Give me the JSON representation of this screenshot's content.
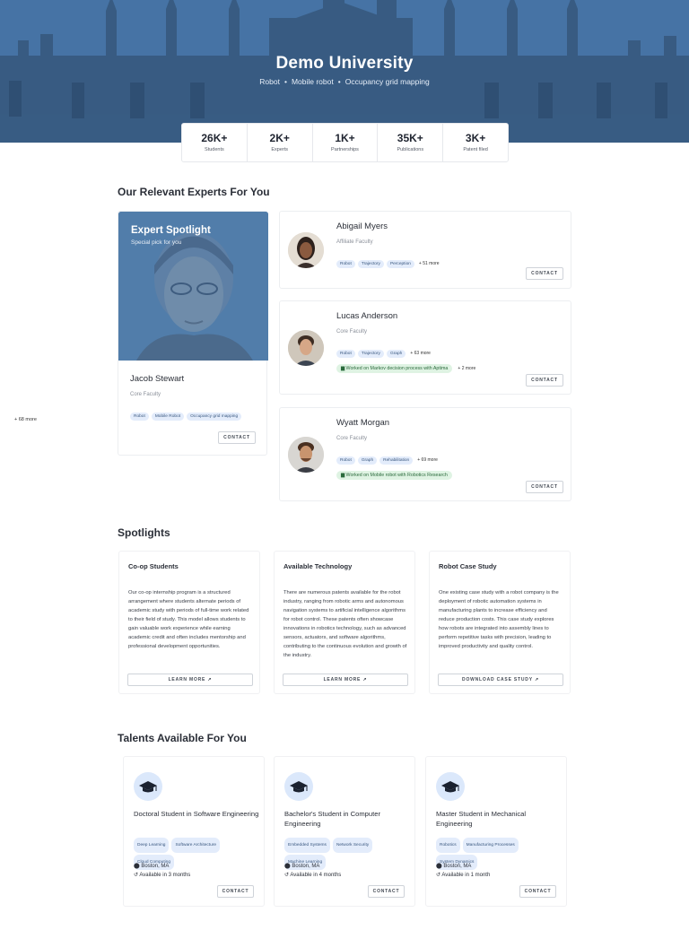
{
  "hero": {
    "title": "Demo University",
    "tags": [
      "Robot",
      "Mobile robot",
      "Occupancy grid mapping"
    ]
  },
  "stats": [
    {
      "value": "26K+",
      "label": "Students"
    },
    {
      "value": "2K+",
      "label": "Experts"
    },
    {
      "value": "1K+",
      "label": "Partnerships"
    },
    {
      "value": "35K+",
      "label": "Publications"
    },
    {
      "value": "3K+",
      "label": "Patent filed"
    }
  ],
  "experts_section": {
    "title": "Our Relevant Experts For You",
    "spotlight": {
      "heading": "Expert Spotlight",
      "subheading": "Special pick for you",
      "name": "Jacob Stewart",
      "role": "Core Faculty",
      "tags": [
        "Robot",
        "Mobile Robot",
        "Occupancy grid mapping"
      ],
      "more": "+ 68 more",
      "contact": "CONTACT"
    },
    "list": [
      {
        "name": "Abigail Myers",
        "role": "Affiliate Faculty",
        "tags": [
          "Robot",
          "Trajectory",
          "Perception"
        ],
        "more": "+ 51 more",
        "worked": "",
        "worked_more": "",
        "contact": "CONTACT"
      },
      {
        "name": "Lucas Anderson",
        "role": "Core Faculty",
        "tags": [
          "Robot",
          "Trajectory",
          "Graph"
        ],
        "more": "+ 63 more",
        "worked": "Worked on Markov decision process with Aptima",
        "worked_more": "+ 2 more",
        "contact": "CONTACT"
      },
      {
        "name": "Wyatt Morgan",
        "role": "Core Faculty",
        "tags": [
          "Robot",
          "Graph",
          "Rehabilitation"
        ],
        "more": "+ 69 more",
        "worked": "Worked on Mobile robot with Robotics Research",
        "worked_more": "",
        "contact": "CONTACT"
      }
    ]
  },
  "spotlights": {
    "title": "Spotlights",
    "cards": [
      {
        "title": "Co-op Students",
        "body": "Our co-op internship program is a structured arrangement where students alternate periods of academic study with periods of full-time work related to their field of study. This model allows students to gain valuable work experience while earning academic credit and often includes mentorship and professional development opportunities.",
        "button": "LEARN MORE"
      },
      {
        "title": "Available Technology",
        "body": "There are numerous patents available for the robot industry, ranging from robotic arms and autonomous navigation systems to artificial intelligence algorithms for robot control. These patents often showcase innovations in robotics technology, such as advanced sensors, actuators, and software algorithms, contributing to the continuous evolution and growth of the industry.",
        "button": "LEARN MORE"
      },
      {
        "title": "Robot Case Study",
        "body": "One existing case study with a robot company is the deployment of robotic automation systems in manufacturing plants to increase efficiency and reduce production costs. This case study explores how robots are integrated into assembly lines to perform repetitive tasks with precision, leading to improved productivity and quality control.",
        "button": "DOWNLOAD CASE STUDY"
      }
    ]
  },
  "talents": {
    "title": "Talents Available For You",
    "cards": [
      {
        "title": "Doctoral Student in Software Engineering",
        "tags": [
          "Deep Learning",
          "Software Architecture",
          "Cloud Computing"
        ],
        "location": "Boston, MA",
        "availability": "Available in 3 months",
        "contact": "CONTACT"
      },
      {
        "title": "Bachelor's Student in Computer Engineering",
        "tags": [
          "Embedded Systems",
          "Network Security",
          "Machine Learning"
        ],
        "location": "Boston, MA",
        "availability": "Available in 4 months",
        "contact": "CONTACT"
      },
      {
        "title": "Master Student in Mechanical Engineering",
        "tags": [
          "Robotics",
          "Manufacturing Processes",
          "System Dynamics"
        ],
        "location": "Boston, MA",
        "availability": "Available in 1 month",
        "contact": "CONTACT"
      }
    ]
  },
  "icons": {
    "external": "external-link-icon",
    "location": "location-pin-icon",
    "availability": "history-icon",
    "graduation": "graduation-cap-icon",
    "briefcase": "briefcase-icon"
  },
  "colors": {
    "tag_bg": "#e3ecfb",
    "worked_bg": "#dff3e3",
    "hero": "#3f6fa3"
  }
}
